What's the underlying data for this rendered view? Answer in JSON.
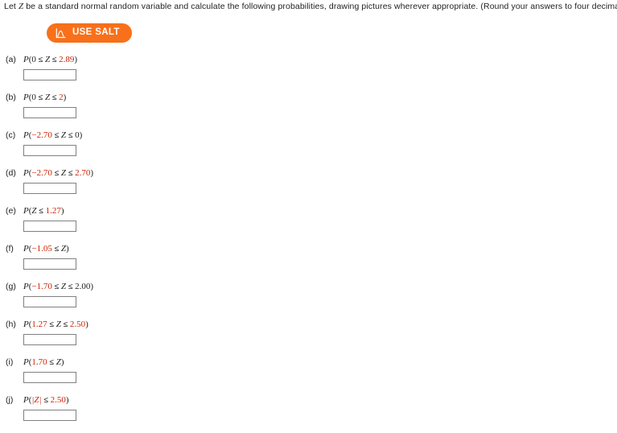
{
  "prompt": {
    "before_var": "Let ",
    "var": "Z",
    "after_var": " be a standard normal random variable and calculate the following probabilities, drawing pictures wherever appropriate. (Round your answers to four decimal places.)"
  },
  "salt_button": {
    "label": "USE SALT",
    "icon": "normal-distribution-chart-icon",
    "background_color": "#f8701a",
    "text_color": "#ffffff"
  },
  "colors": {
    "highlight": "#cc2200",
    "text": "#222222",
    "input_border": "#808080"
  },
  "questions": [
    {
      "label": "(a)",
      "parts": [
        {
          "text": "P",
          "style": "fn"
        },
        {
          "text": "(",
          "style": "plain"
        },
        {
          "text": "0",
          "style": "plain"
        },
        {
          "text": " ≤ ",
          "style": "op"
        },
        {
          "text": "Z",
          "style": "var"
        },
        {
          "text": " ≤ ",
          "style": "op"
        },
        {
          "text": "2.89",
          "style": "hl"
        },
        {
          "text": ")",
          "style": "plain"
        }
      ],
      "answer": "",
      "expr_text": "P(0 ≤ Z ≤ 2.89)"
    },
    {
      "label": "(b)",
      "parts": [
        {
          "text": "P",
          "style": "fn"
        },
        {
          "text": "(",
          "style": "plain"
        },
        {
          "text": "0",
          "style": "plain"
        },
        {
          "text": " ≤ ",
          "style": "op"
        },
        {
          "text": "Z",
          "style": "var"
        },
        {
          "text": " ≤ ",
          "style": "op"
        },
        {
          "text": "2",
          "style": "hl"
        },
        {
          "text": ")",
          "style": "plain"
        }
      ],
      "answer": "",
      "expr_text": "P(0 ≤ Z ≤ 2)"
    },
    {
      "label": "(c)",
      "parts": [
        {
          "text": "P",
          "style": "fn"
        },
        {
          "text": "(",
          "style": "plain"
        },
        {
          "text": "−2.70",
          "style": "hl"
        },
        {
          "text": " ≤ ",
          "style": "op"
        },
        {
          "text": "Z",
          "style": "var"
        },
        {
          "text": " ≤ ",
          "style": "op"
        },
        {
          "text": "0",
          "style": "plain"
        },
        {
          "text": ")",
          "style": "plain"
        }
      ],
      "answer": "",
      "expr_text": "P(−2.70 ≤ Z ≤ 0)"
    },
    {
      "label": "(d)",
      "parts": [
        {
          "text": "P",
          "style": "fn"
        },
        {
          "text": "(",
          "style": "plain"
        },
        {
          "text": "−2.70",
          "style": "hl"
        },
        {
          "text": " ≤ ",
          "style": "op"
        },
        {
          "text": "Z",
          "style": "var"
        },
        {
          "text": " ≤ ",
          "style": "op"
        },
        {
          "text": "2.70",
          "style": "hl"
        },
        {
          "text": ")",
          "style": "plain"
        }
      ],
      "answer": "",
      "expr_text": "P(−2.70 ≤ Z ≤ 2.70)"
    },
    {
      "label": "(e)",
      "parts": [
        {
          "text": "P",
          "style": "fn"
        },
        {
          "text": "(",
          "style": "plain"
        },
        {
          "text": "Z",
          "style": "var"
        },
        {
          "text": " ≤ ",
          "style": "op"
        },
        {
          "text": "1.27",
          "style": "hl"
        },
        {
          "text": ")",
          "style": "plain"
        }
      ],
      "answer": "",
      "expr_text": "P(Z ≤ 1.27)"
    },
    {
      "label": "(f)",
      "parts": [
        {
          "text": "P",
          "style": "fn"
        },
        {
          "text": "(",
          "style": "plain"
        },
        {
          "text": "−1.05",
          "style": "hl"
        },
        {
          "text": " ≤ ",
          "style": "op"
        },
        {
          "text": "Z",
          "style": "var"
        },
        {
          "text": ")",
          "style": "plain"
        }
      ],
      "answer": "",
      "expr_text": "P(−1.05 ≤ Z)"
    },
    {
      "label": "(g)",
      "parts": [
        {
          "text": "P",
          "style": "fn"
        },
        {
          "text": "(",
          "style": "plain"
        },
        {
          "text": "−1.70",
          "style": "hl"
        },
        {
          "text": " ≤ ",
          "style": "op"
        },
        {
          "text": "Z",
          "style": "var"
        },
        {
          "text": " ≤ ",
          "style": "op"
        },
        {
          "text": "2.00",
          "style": "plain"
        },
        {
          "text": ")",
          "style": "plain"
        }
      ],
      "answer": "",
      "expr_text": "P(−1.70 ≤ Z ≤ 2.00)"
    },
    {
      "label": "(h)",
      "parts": [
        {
          "text": "P",
          "style": "fn"
        },
        {
          "text": "(",
          "style": "plain"
        },
        {
          "text": "1.27",
          "style": "hl"
        },
        {
          "text": " ≤ ",
          "style": "op"
        },
        {
          "text": "Z",
          "style": "var"
        },
        {
          "text": " ≤ ",
          "style": "op"
        },
        {
          "text": "2.50",
          "style": "hl"
        },
        {
          "text": ")",
          "style": "plain"
        }
      ],
      "answer": "",
      "expr_text": "P(1.27 ≤ Z ≤ 2.50)"
    },
    {
      "label": "(i)",
      "parts": [
        {
          "text": "P",
          "style": "fn"
        },
        {
          "text": "(",
          "style": "plain"
        },
        {
          "text": "1.70",
          "style": "hl"
        },
        {
          "text": " ≤ ",
          "style": "op"
        },
        {
          "text": "Z",
          "style": "var"
        },
        {
          "text": ")",
          "style": "plain"
        }
      ],
      "answer": "",
      "expr_text": "P(1.70 ≤ Z)"
    },
    {
      "label": "(j)",
      "parts": [
        {
          "text": "P",
          "style": "fn"
        },
        {
          "text": "(",
          "style": "plain"
        },
        {
          "text": "|Z|",
          "style": "hl var"
        },
        {
          "text": " ≤ ",
          "style": "op"
        },
        {
          "text": "2.50",
          "style": "hl"
        },
        {
          "text": ")",
          "style": "plain"
        }
      ],
      "answer": "",
      "expr_text": "P(|Z| ≤ 2.50)"
    }
  ]
}
